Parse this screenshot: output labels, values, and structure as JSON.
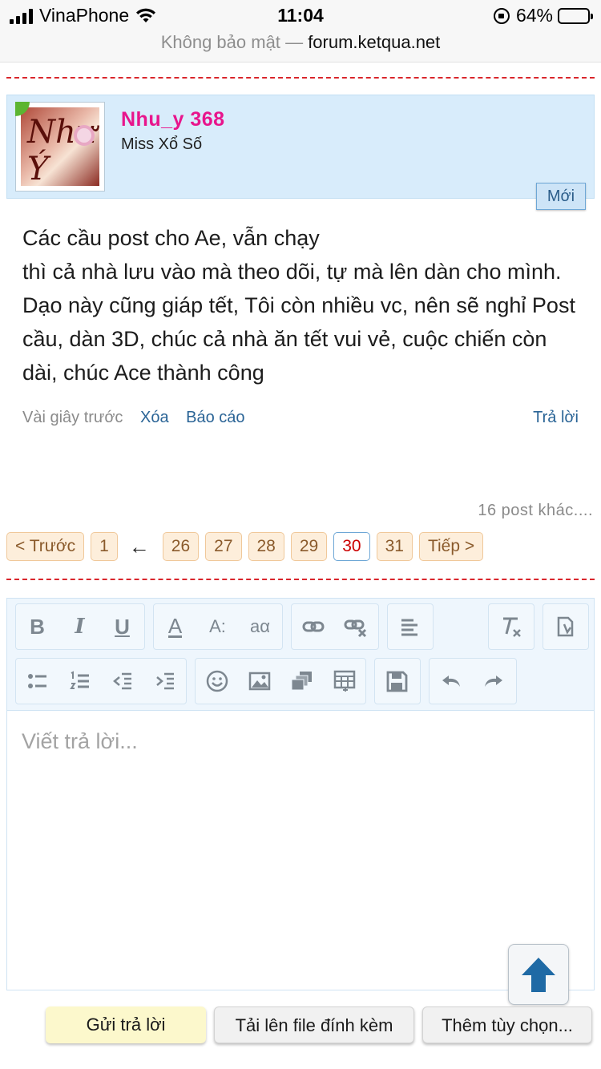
{
  "status_bar": {
    "carrier": "VinaPhone",
    "time": "11:04",
    "battery": "64%",
    "battery_level": 0.64
  },
  "url_bar": {
    "security": "Không bảo mật",
    "separator": "—",
    "host": "forum.ketqua.net"
  },
  "post": {
    "username": "Nhu_y 368",
    "user_title": "Miss Xổ Số",
    "badge": "Mới",
    "avatar_script": "Như Ý",
    "body_line1": "Các cầu post cho Ae, vẫn chạy",
    "body_rest": "thì cả nhà lưu vào mà theo dõi, tự mà lên dàn cho mình. Dạo này cũng giáp tết, Tôi còn nhiều vc, nên sẽ nghỉ Post cầu, dàn 3D, chúc cả nhà ăn tết vui vẻ, cuộc chiến còn dài, chúc Ace thành công",
    "time": "Vài giây trước",
    "delete": "Xóa",
    "report": "Báo cáo",
    "reply": "Trả lời"
  },
  "more_posts": "16 post khác....",
  "pagination": {
    "prev": "< Trước",
    "first": "1",
    "arrow": "←",
    "pages": [
      "26",
      "27",
      "28",
      "29",
      "30",
      "31"
    ],
    "current": "30",
    "next": "Tiếp >"
  },
  "editor": {
    "placeholder": "Viết trả lời...",
    "tools": {
      "bold": "B",
      "italic": "I",
      "underline": "U",
      "font_color": "A",
      "font_size": "A:",
      "text_case": "aα"
    }
  },
  "actions": {
    "send": "Gửi trả lời",
    "upload": "Tải lên file đính kèm",
    "more": "Thêm tùy chọn..."
  },
  "colors": {
    "username": "#e8158c",
    "link": "#2a6496",
    "divider": "#d9262c",
    "header_bg": "#d8ecfb",
    "scroll_arrow": "#1f6aa5"
  }
}
